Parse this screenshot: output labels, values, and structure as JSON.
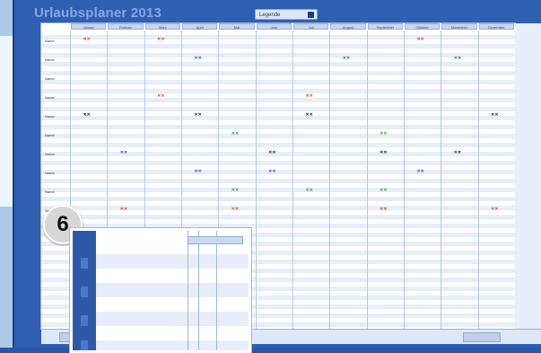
{
  "title": "Urlaubsplaner 2013",
  "legend": {
    "label": "Legende"
  },
  "months": [
    "Januar",
    "Februar",
    "März",
    "April",
    "Mai",
    "Juni",
    "Juli",
    "August",
    "September",
    "Oktober",
    "November",
    "Dezember"
  ],
  "people": [
    "Name",
    "Name",
    "Name",
    "Name",
    "Name",
    "Name",
    "Name",
    "Name",
    "Name",
    "Name"
  ],
  "callout_number": "6",
  "colors": {
    "red": "#e0421d",
    "blue": "#3a4fc4",
    "black": "#222222",
    "green": "#34a34a"
  },
  "marks": [
    {
      "row": 0,
      "col": 0,
      "color": "red"
    },
    {
      "row": 0,
      "col": 2,
      "color": "red"
    },
    {
      "row": 0,
      "col": 9,
      "color": "red"
    },
    {
      "row": 1,
      "col": 3,
      "color": "blue"
    },
    {
      "row": 1,
      "col": 7,
      "color": "blue"
    },
    {
      "row": 1,
      "col": 10,
      "color": "blue"
    },
    {
      "row": 3,
      "col": 2,
      "color": "red"
    },
    {
      "row": 3,
      "col": 6,
      "color": "red"
    },
    {
      "row": 4,
      "col": 0,
      "color": "black"
    },
    {
      "row": 4,
      "col": 3,
      "color": "black"
    },
    {
      "row": 4,
      "col": 6,
      "color": "black"
    },
    {
      "row": 4,
      "col": 11,
      "color": "black"
    },
    {
      "row": 5,
      "col": 4,
      "color": "green"
    },
    {
      "row": 5,
      "col": 8,
      "color": "green"
    },
    {
      "row": 5,
      "col": 12,
      "color": "green"
    },
    {
      "row": 6,
      "col": 1,
      "color": "blue"
    },
    {
      "row": 6,
      "col": 5,
      "color": "black"
    },
    {
      "row": 6,
      "col": 8,
      "color": "black"
    },
    {
      "row": 6,
      "col": 10,
      "color": "black"
    },
    {
      "row": 7,
      "col": 3,
      "color": "blue"
    },
    {
      "row": 7,
      "col": 5,
      "color": "blue"
    },
    {
      "row": 7,
      "col": 9,
      "color": "blue"
    },
    {
      "row": 8,
      "col": 4,
      "color": "green"
    },
    {
      "row": 8,
      "col": 6,
      "color": "green"
    },
    {
      "row": 8,
      "col": 8,
      "color": "green"
    },
    {
      "row": 8,
      "col": 12,
      "color": "green"
    },
    {
      "row": 9,
      "col": 1,
      "color": "red"
    },
    {
      "row": 9,
      "col": 4,
      "color": "red"
    },
    {
      "row": 9,
      "col": 8,
      "color": "red"
    },
    {
      "row": 9,
      "col": 11,
      "color": "red"
    }
  ]
}
